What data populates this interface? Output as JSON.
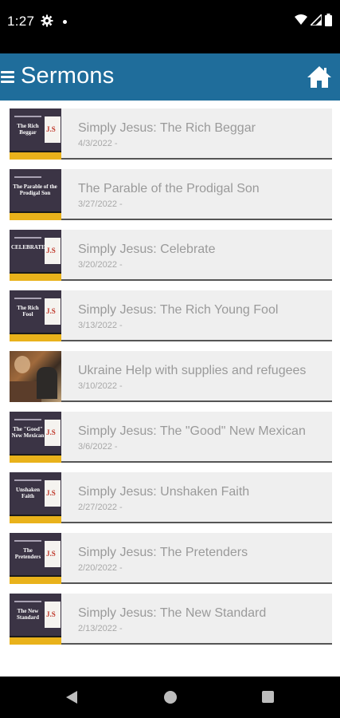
{
  "status_bar": {
    "time": "1:27",
    "icons": [
      "gear-icon",
      "notification-dot-icon",
      "wifi-icon",
      "signal-icon",
      "battery-icon"
    ]
  },
  "header": {
    "title": "Sermons",
    "color": "#1f6d9b",
    "menu_icon": "hamburger-menu-icon",
    "home_icon": "home-icon"
  },
  "sermons": [
    {
      "title": "Simply Jesus: The Rich Beggar",
      "date": "4/3/2022 -",
      "thumb_text": "The Rich Beggar",
      "thumb_type": "series"
    },
    {
      "title": "The Parable of the Prodigal Son",
      "date": "3/27/2022 -",
      "thumb_text": "The Parable of the Prodigal Son",
      "thumb_type": "plain"
    },
    {
      "title": "Simply Jesus: Celebrate",
      "date": "3/20/2022 -",
      "thumb_text": "CELEBRATE",
      "thumb_type": "series"
    },
    {
      "title": "Simply Jesus: The Rich Young Fool",
      "date": "3/13/2022 -",
      "thumb_text": "The Rich Fool",
      "thumb_type": "series"
    },
    {
      "title": "Ukraine Help with supplies and refugees",
      "date": "3/10/2022 -",
      "thumb_text": "",
      "thumb_type": "photo"
    },
    {
      "title": "Simply Jesus: The \"Good\" New Mexican",
      "date": "3/6/2022 -",
      "thumb_text": "The \"Good\" New Mexican",
      "thumb_type": "series"
    },
    {
      "title": "Simply Jesus: Unshaken Faith",
      "date": "2/27/2022 -",
      "thumb_text": "Unshaken Faith",
      "thumb_type": "series"
    },
    {
      "title": "Simply Jesus: The Pretenders",
      "date": "2/20/2022 -",
      "thumb_text": "The Pretenders",
      "thumb_type": "series"
    },
    {
      "title": "Simply Jesus: The New Standard",
      "date": "2/13/2022 -",
      "thumb_text": "The New Standard",
      "thumb_type": "series"
    }
  ],
  "nav_bar": {
    "icons": [
      "back-icon",
      "home-circle-icon",
      "recents-icon"
    ]
  }
}
